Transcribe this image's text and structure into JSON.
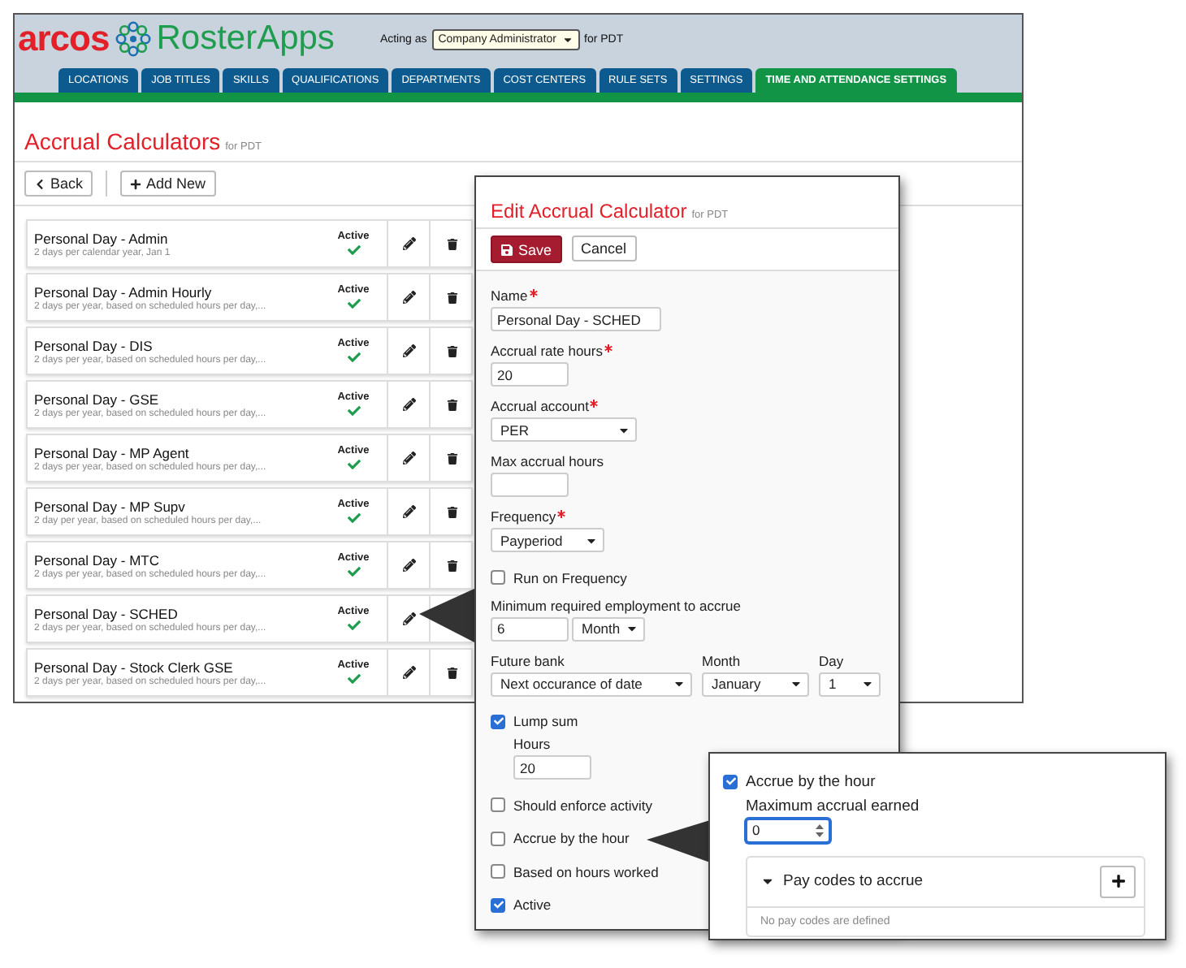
{
  "header": {
    "logo_brand": "arcos",
    "logo_product": "RosterApps",
    "acting_as_label": "Acting as",
    "role_select": "Company Administrator",
    "for_label": "for PDT"
  },
  "tabs": [
    {
      "label": "LOCATIONS",
      "selected": false
    },
    {
      "label": "JOB TITLES",
      "selected": false
    },
    {
      "label": "SKILLS",
      "selected": false
    },
    {
      "label": "QUALIFICATIONS",
      "selected": false
    },
    {
      "label": "DEPARTMENTS",
      "selected": false
    },
    {
      "label": "COST CENTERS",
      "selected": false
    },
    {
      "label": "RULE SETS",
      "selected": false
    },
    {
      "label": "SETTINGS",
      "selected": false
    },
    {
      "label": "TIME AND ATTENDANCE SETTINGS",
      "selected": true
    }
  ],
  "page": {
    "title": "Accrual Calculators",
    "subtitle": "for PDT",
    "buttons": [
      {
        "kind": "back",
        "label": "Back"
      },
      {
        "kind": "add",
        "label": "Add New"
      }
    ]
  },
  "calculators": [
    {
      "name": "Personal Day - Admin",
      "description": "2 days per calendar year, Jan 1",
      "status": "Active",
      "active": true
    },
    {
      "name": "Personal Day - Admin Hourly",
      "description": "2 days per year, based on scheduled hours per day,...",
      "status": "Active",
      "active": true
    },
    {
      "name": "Personal Day - DIS",
      "description": "2 days per year, based on scheduled hours per day,...",
      "status": "Active",
      "active": true
    },
    {
      "name": "Personal Day - GSE",
      "description": "2 days per year, based on scheduled hours per day,...",
      "status": "Active",
      "active": true
    },
    {
      "name": "Personal Day - MP Agent",
      "description": "2 days per year, based on scheduled hours per day,...",
      "status": "Active",
      "active": true
    },
    {
      "name": "Personal Day - MP Supv",
      "description": "2 day per year, based on scheduled hours per day,...",
      "status": "Active",
      "active": true
    },
    {
      "name": "Personal Day - MTC",
      "description": "2 days per year, based on scheduled hours per day,...",
      "status": "Active",
      "active": true
    },
    {
      "name": "Personal Day - SCHED",
      "description": "2 days per year, based on scheduled hours per day,...",
      "status": "Active",
      "active": true
    },
    {
      "name": "Personal Day - Stock Clerk GSE",
      "description": "2 days per year, based on scheduled hours per day,...",
      "status": "Active",
      "active": true
    }
  ],
  "edit_panel": {
    "title": "Edit Accrual Calculator",
    "subtitle": "for PDT",
    "save": "Save",
    "cancel": "Cancel",
    "fields": [
      {
        "kind": "text",
        "label": "Name",
        "required": true,
        "value": "Personal Day - SCHED"
      },
      {
        "kind": "text",
        "label": "Accrual rate hours",
        "required": true,
        "value": "20"
      },
      {
        "kind": "select",
        "label": "Accrual account",
        "required": true,
        "value": "PER"
      },
      {
        "kind": "text",
        "label": "Max accrual hours",
        "required": false
      },
      {
        "kind": "select",
        "label": "Frequency",
        "required": true,
        "value": "Payperiod"
      },
      {
        "kind": "checkbox",
        "label": "Run on Frequency",
        "checked": false
      },
      {
        "kind": "number-unit",
        "label": "Minimum required employment to accrue",
        "value": "6",
        "unit": "Month"
      },
      {
        "kind": "date-row",
        "columns": [
          {
            "label": "Future bank",
            "value": "Next occurance of date"
          },
          {
            "label": "Month",
            "value": "January"
          },
          {
            "label": "Day",
            "value": "1"
          }
        ]
      },
      {
        "kind": "checkbox",
        "label": "Lump sum",
        "checked": true,
        "sub_label": "Hours",
        "sub_value": "20"
      },
      {
        "kind": "checkbox",
        "label": "Should enforce activity",
        "checked": false
      },
      {
        "kind": "checkbox",
        "label": "Accrue by the hour",
        "checked": false
      },
      {
        "kind": "checkbox",
        "label": "Based on hours worked",
        "checked": false
      },
      {
        "kind": "checkbox",
        "label": "Active",
        "checked": true
      }
    ]
  },
  "callout": {
    "label": "Accrue by the hour",
    "checked": true,
    "max_label": "Maximum accrual earned",
    "max_value": "0",
    "section": {
      "title": "Pay codes to accrue",
      "expanded": true,
      "empty_text": "No pay codes are defined"
    }
  }
}
